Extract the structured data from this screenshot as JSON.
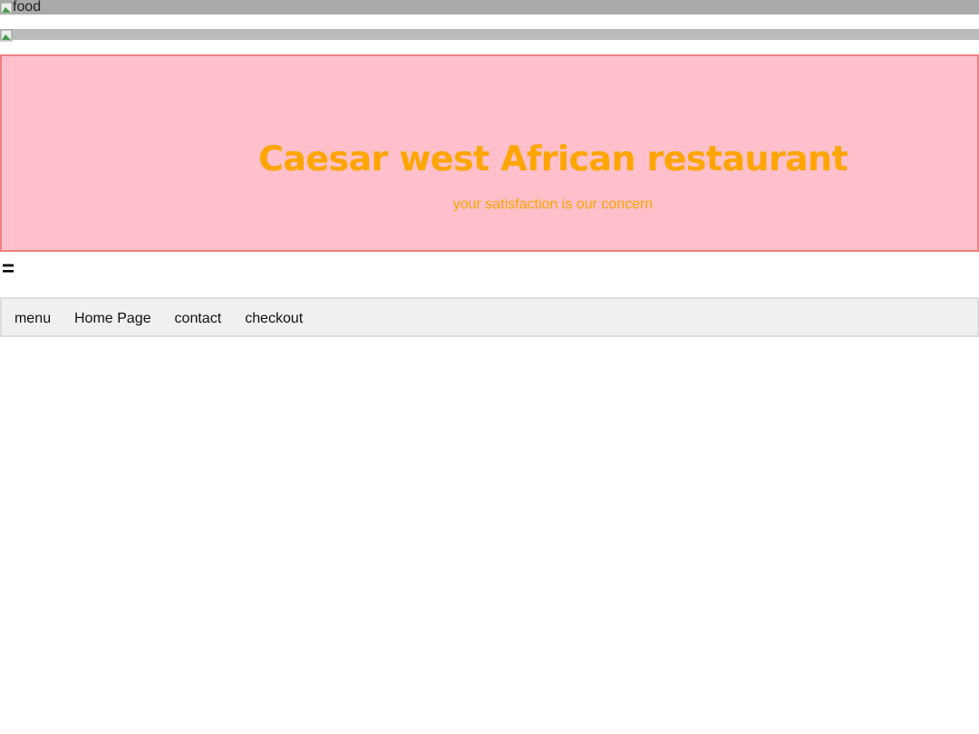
{
  "top_image": {
    "alt": "food"
  },
  "header": {
    "title": "Caesar west African restaurant",
    "tagline": "your satisfaction is our concern"
  },
  "menu_toggle": "=",
  "nav": {
    "links": [
      {
        "label": "menu"
      },
      {
        "label": "Home Page"
      },
      {
        "label": "contact"
      },
      {
        "label": "checkout"
      }
    ]
  }
}
